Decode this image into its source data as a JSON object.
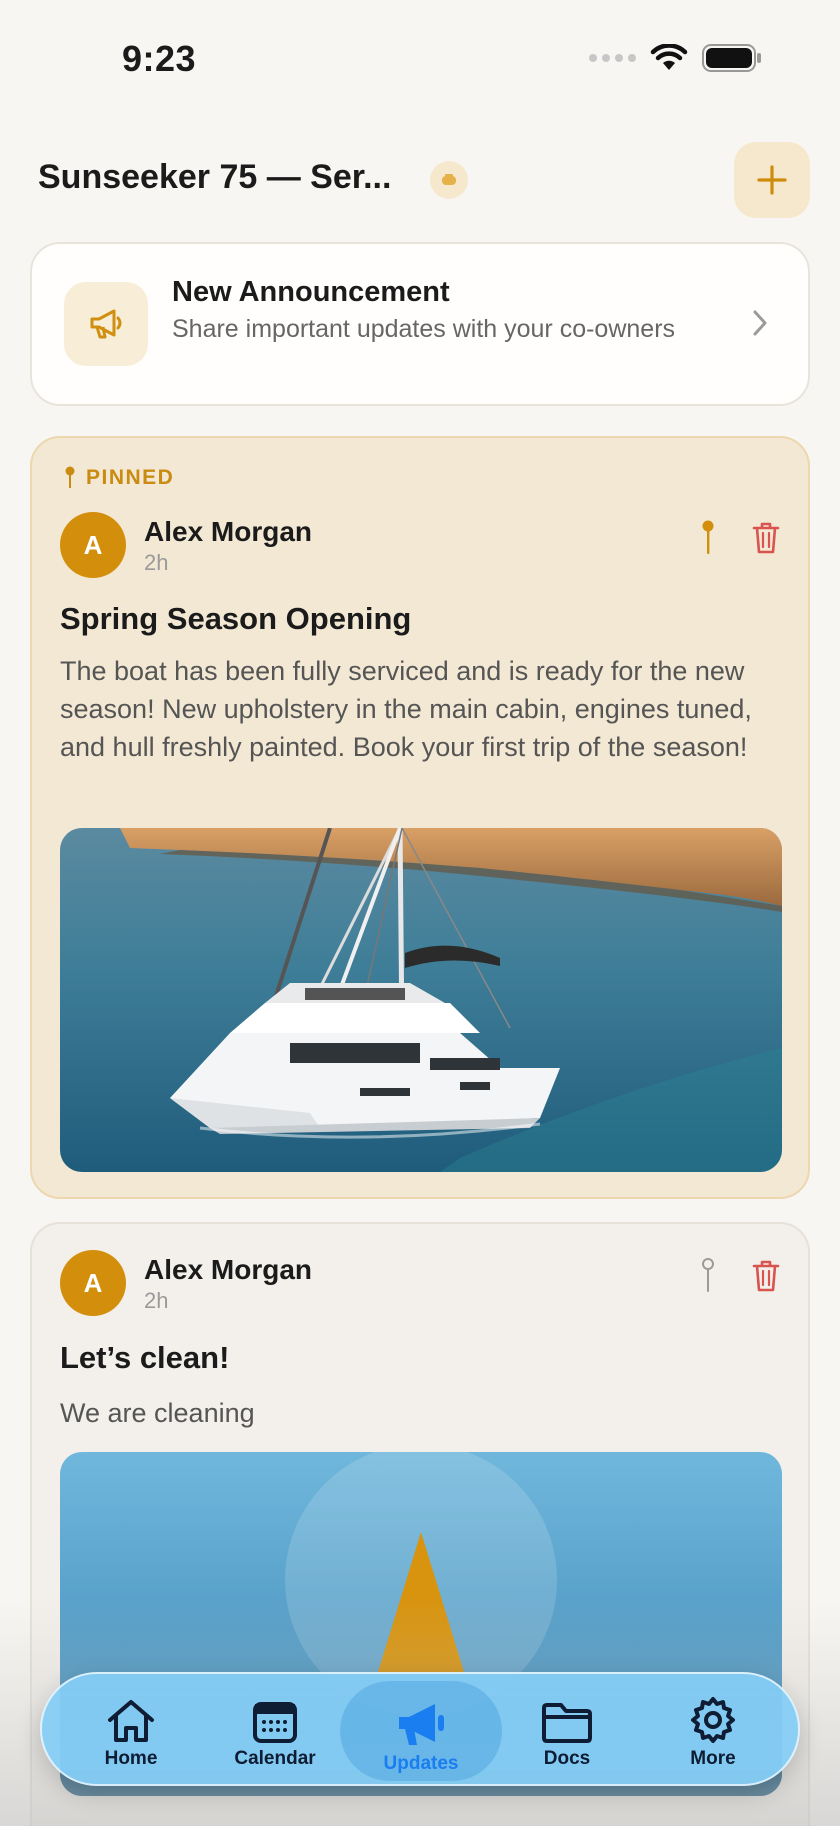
{
  "status_bar": {
    "time": "9:23"
  },
  "header": {
    "title": "Sunseeker 75 — Ser...",
    "add_button_label": "+"
  },
  "announcement_card": {
    "title": "New Announcement",
    "subtitle": "Share important updates with your co-owners"
  },
  "posts": [
    {
      "pinned_label": "PINNED",
      "avatar_initial": "A",
      "author": "Alex Morgan",
      "time": "2h",
      "title": "Spring Season Opening",
      "body": "The boat has been fully serviced and is ready for the new season! New upholstery in the main cabin, engines tuned, and hull freshly painted. Book your first trip of the season!"
    },
    {
      "avatar_initial": "A",
      "author": "Alex Morgan",
      "time": "2h",
      "title": "Let’s clean!",
      "body": "We are cleaning"
    }
  ],
  "tab_bar": {
    "tabs": [
      {
        "label": "Home",
        "icon": "house-icon"
      },
      {
        "label": "Calendar",
        "icon": "calendar-icon"
      },
      {
        "label": "Updates",
        "icon": "megaphone-icon",
        "active": true
      },
      {
        "label": "Docs",
        "icon": "folder-icon"
      },
      {
        "label": "More",
        "icon": "gear-icon"
      }
    ]
  },
  "colors": {
    "accent_gold": "#d38e0c",
    "active_tab_blue": "#1a7df0",
    "delete_red": "#d9534f",
    "tab_bar_bg": "#84cdf6"
  }
}
